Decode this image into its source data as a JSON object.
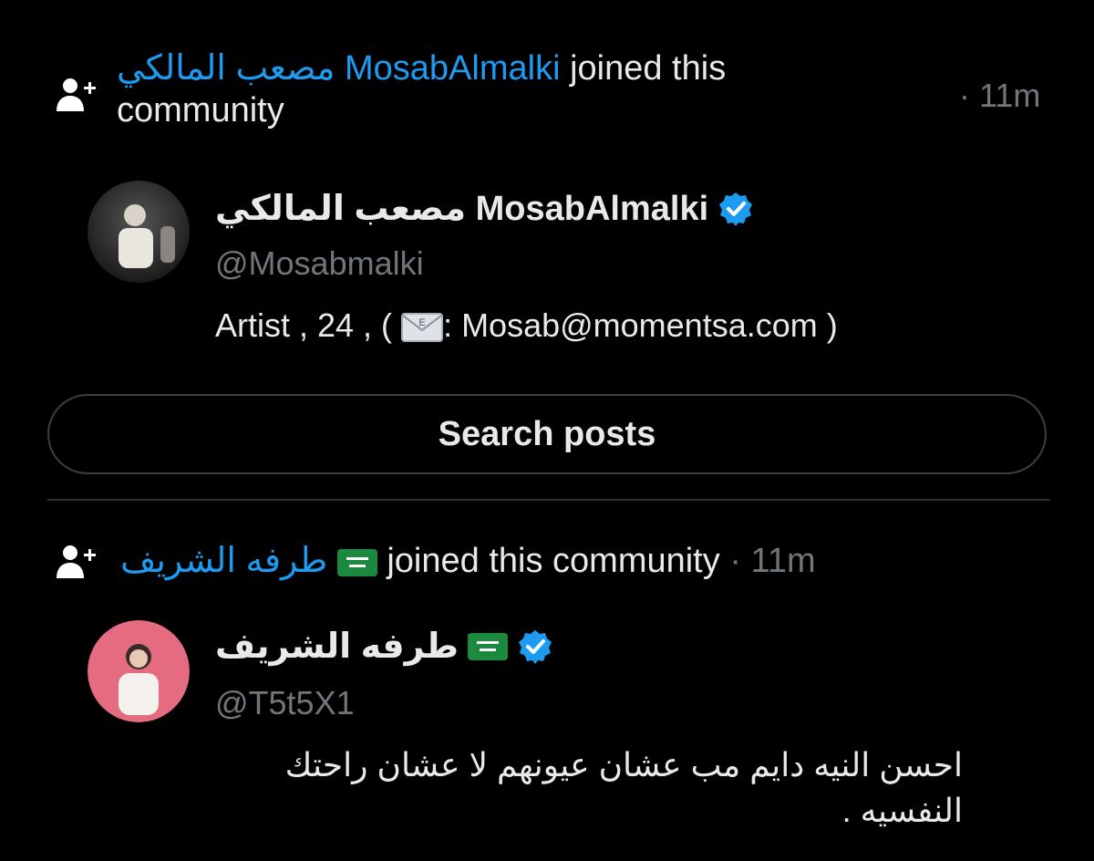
{
  "activity1": {
    "user_name": "مصعب المالكي MosabAlmalki",
    "action_line1": "joined this",
    "action_line2": "community",
    "time": "· 11m"
  },
  "profile1": {
    "display_name": "مصعب المالكي MosabAlmalki",
    "handle": "@Mosabmalki",
    "bio_prefix": "Artist , 24 , (",
    "bio_email": ": Mosab@momentsa.com )",
    "icon": "envelope-icon"
  },
  "search": {
    "label": "Search posts"
  },
  "activity2": {
    "user_name": "طرفه الشريف",
    "action": "joined this community",
    "time": "· 11m",
    "flag": "saudi-flag"
  },
  "profile2": {
    "display_name": "طرفه الشريف",
    "handle": "@T5t5X1",
    "bio_line1": "احسن النيه دايم مب عشان عيونهم لا عشان راحتك",
    "bio_line2": "النفسيه ."
  },
  "colors": {
    "background": "#000000",
    "accent": "#1d9bf0",
    "text": "#e7e9ea",
    "muted": "#71767b",
    "verified": "#1d9bf0"
  }
}
